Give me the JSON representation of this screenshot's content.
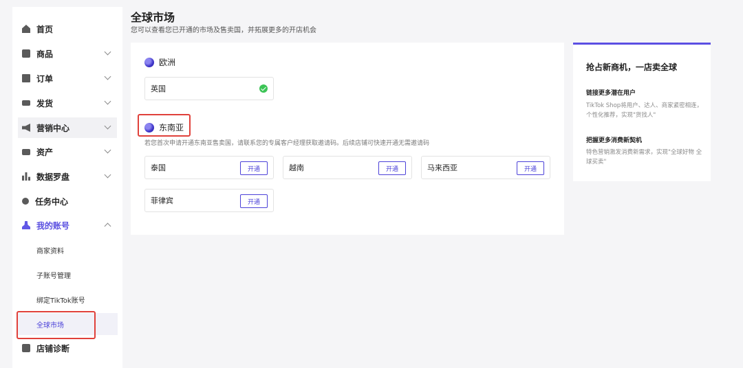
{
  "header": {
    "title": "全球市场",
    "description": "您可以查看您已开通的市场及售卖国，并拓展更多的开店机会"
  },
  "sidebar": {
    "items": [
      {
        "label": "首页",
        "icon": "home-icon"
      },
      {
        "label": "商品",
        "icon": "product-icon"
      },
      {
        "label": "订单",
        "icon": "order-icon"
      },
      {
        "label": "发货",
        "icon": "truck-icon"
      },
      {
        "label": "营销中心",
        "icon": "megaphone-icon"
      },
      {
        "label": "资产",
        "icon": "card-icon"
      },
      {
        "label": "数据罗盘",
        "icon": "chart-icon"
      },
      {
        "label": "任务中心",
        "icon": "medal-icon"
      },
      {
        "label": "我的账号",
        "icon": "user-icon"
      },
      {
        "label": "店铺诊断",
        "icon": "shop-icon"
      }
    ],
    "account_sub": [
      {
        "label": "商家资料"
      },
      {
        "label": "子账号管理"
      },
      {
        "label": "绑定TikTok账号"
      },
      {
        "label": "全球市场"
      }
    ]
  },
  "regions": {
    "europe": {
      "name": "欧洲",
      "countries": [
        {
          "name": "英国",
          "status": "opened"
        }
      ]
    },
    "sea": {
      "name": "东南亚",
      "description": "若您首次申请开通东南亚售卖国，请联系您的专属客户经理获取邀请码。后续店铺可快速开通无需邀请码",
      "button_label": "开通",
      "countries": [
        {
          "name": "泰国"
        },
        {
          "name": "越南"
        },
        {
          "name": "马来西亚"
        },
        {
          "name": "菲律宾"
        }
      ]
    }
  },
  "promo": {
    "title": "抢占新商机，一店卖全球",
    "sections": [
      {
        "heading": "链接更多潜在用户",
        "text": "TikTok Shop将用户、达人、商家紧密相连，个性化推荐，实现\"货找人\""
      },
      {
        "heading": "把握更多消费新契机",
        "text": "特色营销激发消费新需求，实现\"全球好物 全球买卖\""
      }
    ]
  },
  "colors": {
    "accent": "#4a40d8",
    "success": "#3cc456",
    "highlight_border": "#e0403a"
  }
}
